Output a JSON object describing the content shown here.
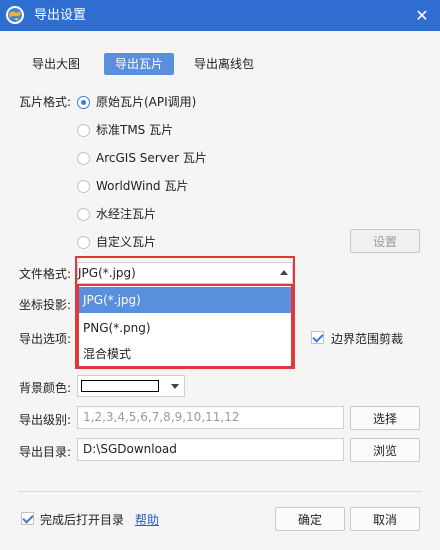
{
  "window": {
    "title": "导出设置",
    "close_label": "✕"
  },
  "tabs": [
    {
      "label": "导出大图",
      "active": false
    },
    {
      "label": "导出瓦片",
      "active": true
    },
    {
      "label": "导出离线包",
      "active": false
    }
  ],
  "tile_format": {
    "label": "瓦片格式:",
    "options": [
      {
        "label": "原始瓦片(API调用)",
        "checked": true
      },
      {
        "label": "标准TMS 瓦片",
        "checked": false
      },
      {
        "label": "ArcGIS Server 瓦片",
        "checked": false
      },
      {
        "label": "WorldWind 瓦片",
        "checked": false
      },
      {
        "label": "水经注瓦片",
        "checked": false
      },
      {
        "label": "自定义瓦片",
        "checked": false
      }
    ],
    "settings_button": "设置"
  },
  "file_format": {
    "label": "文件格式:",
    "value": "JPG(*.jpg)",
    "options": [
      "JPG(*.jpg)",
      "PNG(*.png)",
      "混合模式"
    ]
  },
  "projection": {
    "label": "坐标投影:"
  },
  "export_options": {
    "label": "导出选项:",
    "clip_label": "边界范围剪裁",
    "clip_checked": true
  },
  "background": {
    "label": "背景颜色:",
    "color": "#ffffff"
  },
  "levels": {
    "label": "导出级别:",
    "placeholder": "1,2,3,4,5,6,7,8,9,10,11,12",
    "button": "选择"
  },
  "directory": {
    "label": "导出目录:",
    "value": "D:\\SGDownload",
    "button": "浏览"
  },
  "footer": {
    "open_dir_label": "完成后打开目录",
    "open_dir_checked": true,
    "help_link": "帮助",
    "ok_button": "确定",
    "cancel_button": "取消"
  },
  "colors": {
    "titlebar": "#2f6dd1",
    "accent": "#5a8fde",
    "highlight": "#e0383a",
    "link": "#1e5fcf"
  }
}
